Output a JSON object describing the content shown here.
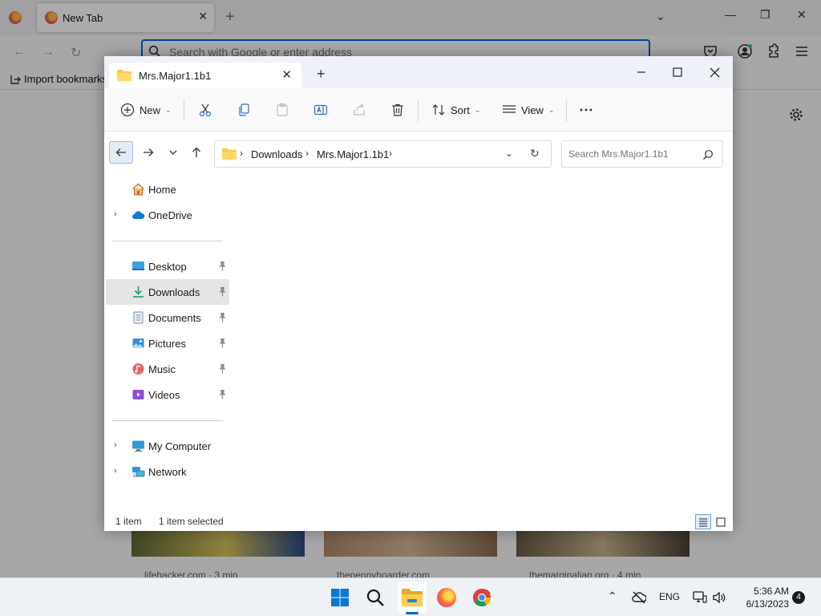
{
  "browser": {
    "tab_title": "New Tab",
    "url_placeholder": "Search with Google or enter address",
    "import_bookmarks": "Import bookmarks",
    "stories": [
      {
        "meta": "lifehacker.com · 3 min"
      },
      {
        "meta": "thepennyhoarder.com"
      },
      {
        "meta": "themarginalian.org · 4 min"
      }
    ]
  },
  "explorer": {
    "tab_title": "Mrs.Major1.1b1",
    "toolbar": {
      "new_label": "New",
      "sort_label": "Sort",
      "view_label": "View"
    },
    "breadcrumb": [
      "Downloads",
      "Mrs.Major1.1b1"
    ],
    "search_placeholder": "Search Mrs.Major1.1b1",
    "nav": {
      "home": "Home",
      "onedrive": "OneDrive",
      "desktop": "Desktop",
      "downloads": "Downloads",
      "documents": "Documents",
      "pictures": "Pictures",
      "music": "Music",
      "videos": "Videos",
      "my_computer": "My Computer",
      "network": "Network"
    },
    "status": {
      "count": "1 item",
      "selected": "1 item selected"
    }
  },
  "taskbar": {
    "language": "ENG",
    "time": "5:36 AM",
    "date": "6/13/2023",
    "notifications": "4"
  },
  "colors": {
    "accent": "#0067c0",
    "folder_yellow": "#f7c843",
    "selected_bg": "#e5e5e5"
  }
}
